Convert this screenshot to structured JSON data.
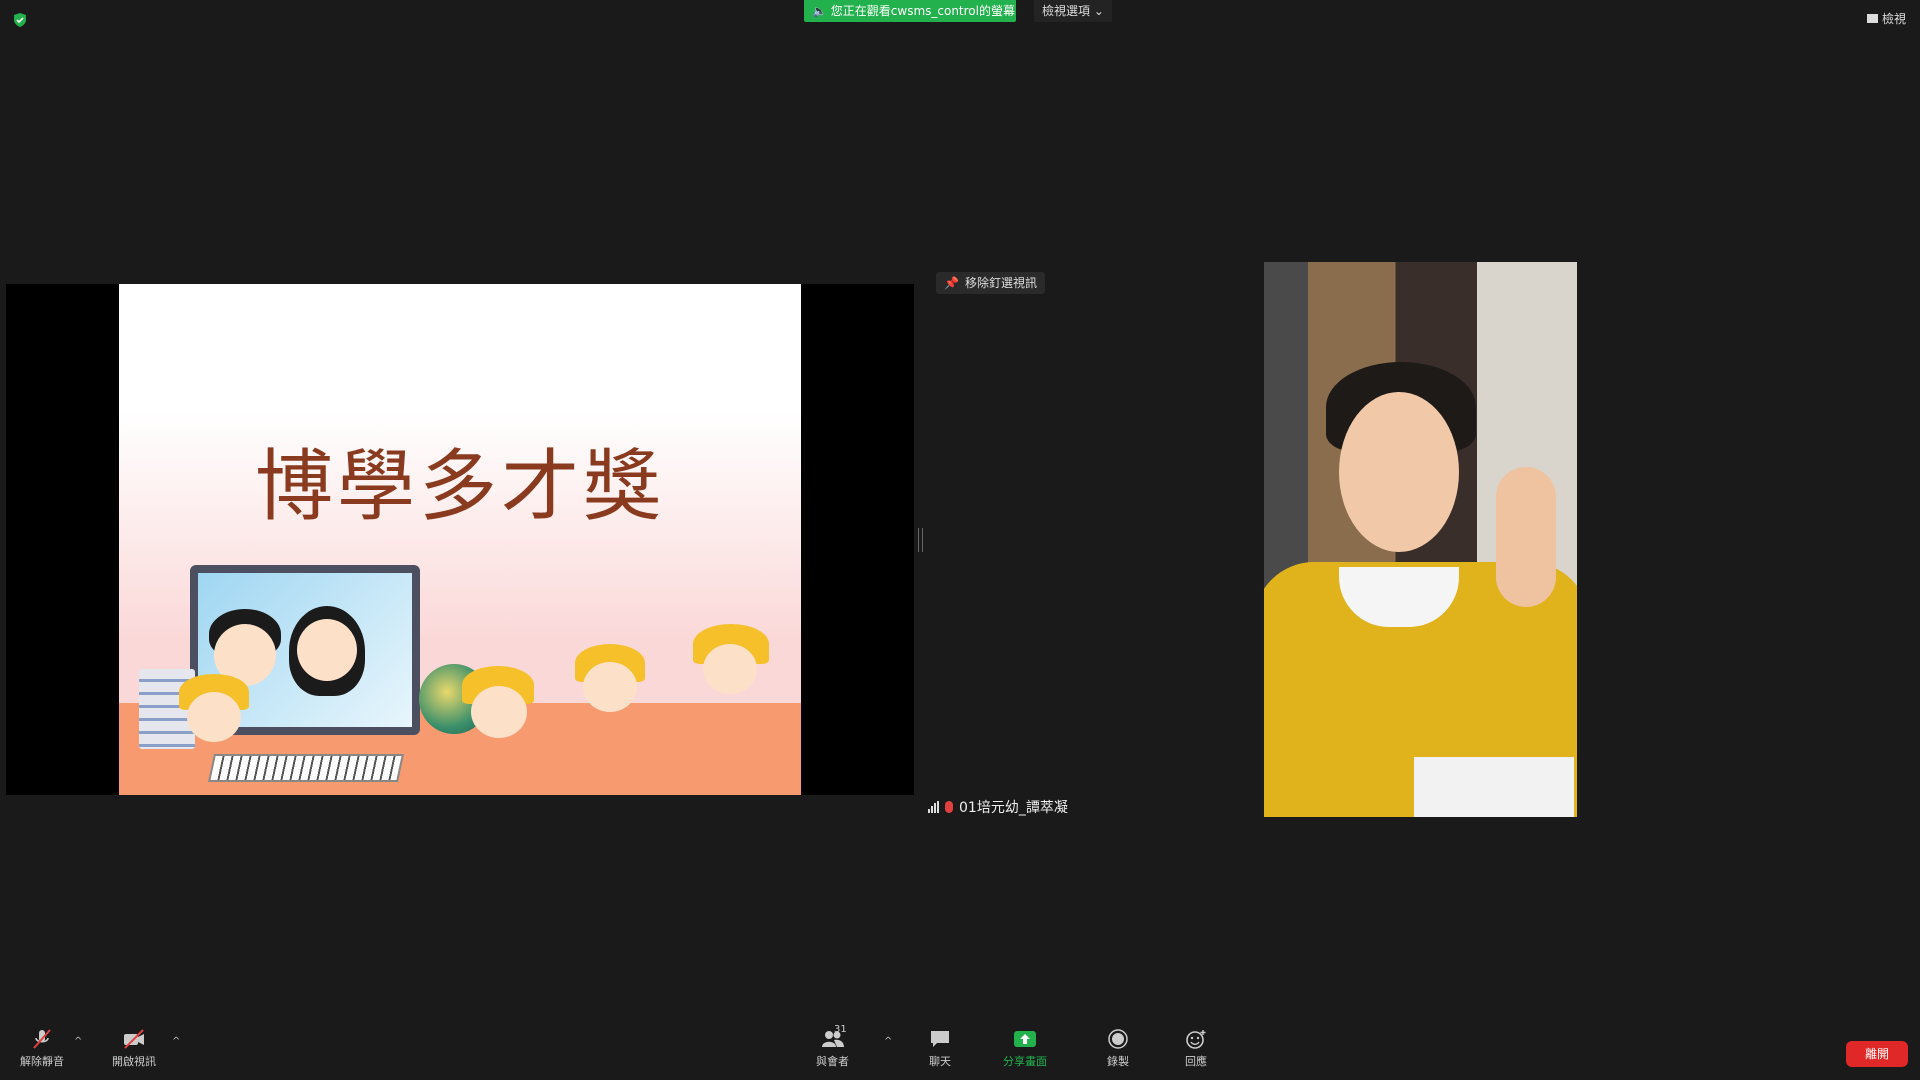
{
  "topbar": {
    "viewing_text": "您正在觀看cwsms_control的螢幕",
    "view_options": "檢視選項 ⌄",
    "view_button": "檢視"
  },
  "slide": {
    "title": "博學多才獎"
  },
  "video": {
    "pin_label": "移除釘選視訊",
    "participant_name": "01培元幼_譚萃凝"
  },
  "toolbar": {
    "unmute_label": "解除靜音",
    "start_video_label": "開啟視訊",
    "participants_label": "與會者",
    "participants_count": "31",
    "chat_label": "聊天",
    "share_label": "分享畫面",
    "record_label": "錄製",
    "reactions_label": "回應",
    "leave_label": "離開"
  },
  "colors": {
    "share_green": "#22b14c",
    "leave_red": "#e02828",
    "background": "#1a1a1a",
    "title_brown": "#8a3a1e"
  },
  "icons": [
    "shield-icon",
    "speaker-icon",
    "pin-icon",
    "signal-icon",
    "muted-mic-icon",
    "participants-icon",
    "chat-icon",
    "share-screen-icon",
    "record-icon",
    "reaction-icon",
    "video-off-icon"
  ]
}
